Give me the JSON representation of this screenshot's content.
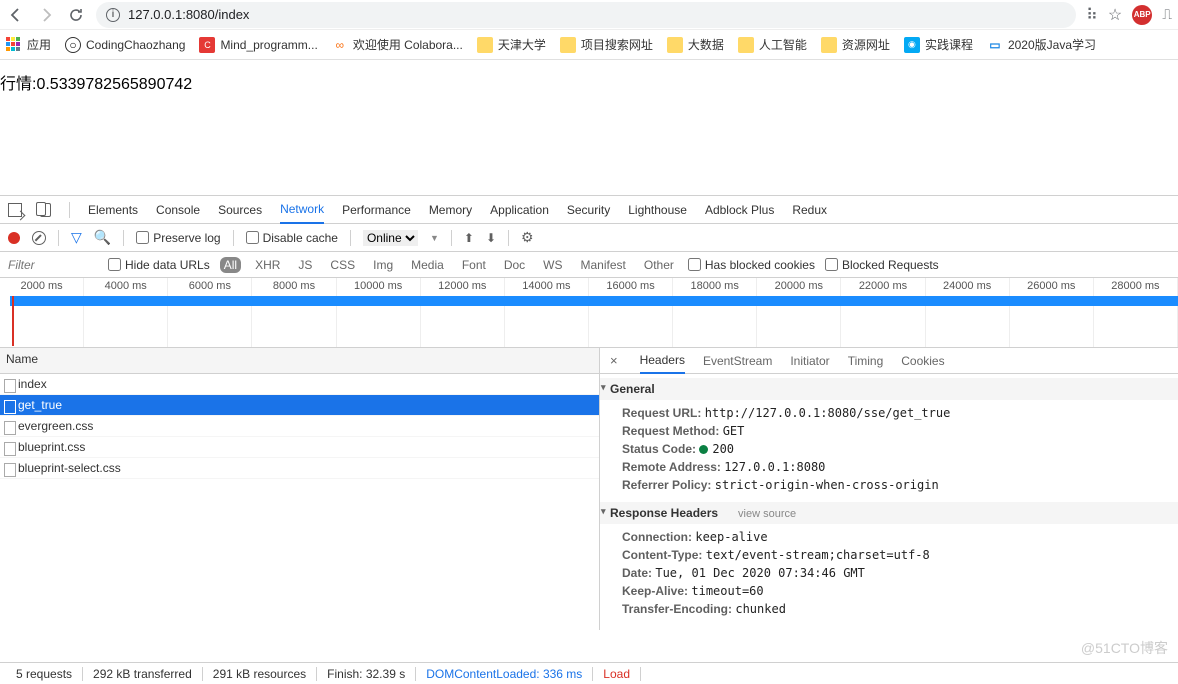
{
  "toolbar": {
    "url": "127.0.0.1:8080/index"
  },
  "bookmarks": {
    "apps": "应用",
    "items": [
      {
        "icon": "gh",
        "label": "CodingChaozhang"
      },
      {
        "icon": "red",
        "label": "Mind_programm..."
      },
      {
        "icon": "link",
        "label": "欢迎使用 Colabora..."
      },
      {
        "icon": "f",
        "label": "天津大学"
      },
      {
        "icon": "f",
        "label": "项目搜索网址"
      },
      {
        "icon": "f",
        "label": "大数据"
      },
      {
        "icon": "f",
        "label": "人工智能"
      },
      {
        "icon": "f",
        "label": "资源网址"
      },
      {
        "icon": "blue",
        "label": "实践课程"
      },
      {
        "icon": "tv",
        "label": "2020版Java学习"
      }
    ]
  },
  "page": {
    "text": "行情:0.5339782565890742"
  },
  "devtabs": [
    "Elements",
    "Console",
    "Sources",
    "Network",
    "Performance",
    "Memory",
    "Application",
    "Security",
    "Lighthouse",
    "Adblock Plus",
    "Redux"
  ],
  "devtabs_active": "Network",
  "nettb": {
    "preserve": "Preserve log",
    "disable": "Disable cache",
    "throttle": "Online"
  },
  "filters": {
    "placeholder": "Filter",
    "hide": "Hide data URLs",
    "types": [
      "All",
      "XHR",
      "JS",
      "CSS",
      "Img",
      "Media",
      "Font",
      "Doc",
      "WS",
      "Manifest",
      "Other"
    ],
    "types_active": "All",
    "blocked_cookies": "Has blocked cookies",
    "blocked_req": "Blocked Requests"
  },
  "timeline": {
    "ticks": [
      "2000 ms",
      "4000 ms",
      "6000 ms",
      "8000 ms",
      "10000 ms",
      "12000 ms",
      "14000 ms",
      "16000 ms",
      "18000 ms",
      "20000 ms",
      "22000 ms",
      "24000 ms",
      "26000 ms",
      "28000 ms"
    ]
  },
  "reqlist": {
    "header": "Name",
    "items": [
      "index",
      "get_true",
      "evergreen.css",
      "blueprint.css",
      "blueprint-select.css"
    ],
    "selected": "get_true"
  },
  "rtabs": [
    "Headers",
    "EventStream",
    "Initiator",
    "Timing",
    "Cookies"
  ],
  "rtabs_active": "Headers",
  "general": {
    "title": "General",
    "url_k": "Request URL:",
    "url_v": "http://127.0.0.1:8080/sse/get_true",
    "method_k": "Request Method:",
    "method_v": "GET",
    "status_k": "Status Code:",
    "status_v": "200",
    "remote_k": "Remote Address:",
    "remote_v": "127.0.0.1:8080",
    "ref_k": "Referrer Policy:",
    "ref_v": "strict-origin-when-cross-origin"
  },
  "resp": {
    "title": "Response Headers",
    "view": "view source",
    "conn_k": "Connection:",
    "conn_v": "keep-alive",
    "ct_k": "Content-Type:",
    "ct_v": "text/event-stream;charset=utf-8",
    "date_k": "Date:",
    "date_v": "Tue, 01 Dec 2020 07:34:46 GMT",
    "ka_k": "Keep-Alive:",
    "ka_v": "timeout=60",
    "te_k": "Transfer-Encoding:",
    "te_v": "chunked"
  },
  "status": {
    "requests": "5 requests",
    "transferred": "292 kB transferred",
    "resources": "291 kB resources",
    "finish": "Finish: 32.39 s",
    "dcl": "DOMContentLoaded: 336 ms",
    "load": "Load"
  },
  "watermark": "@51CTO博客"
}
